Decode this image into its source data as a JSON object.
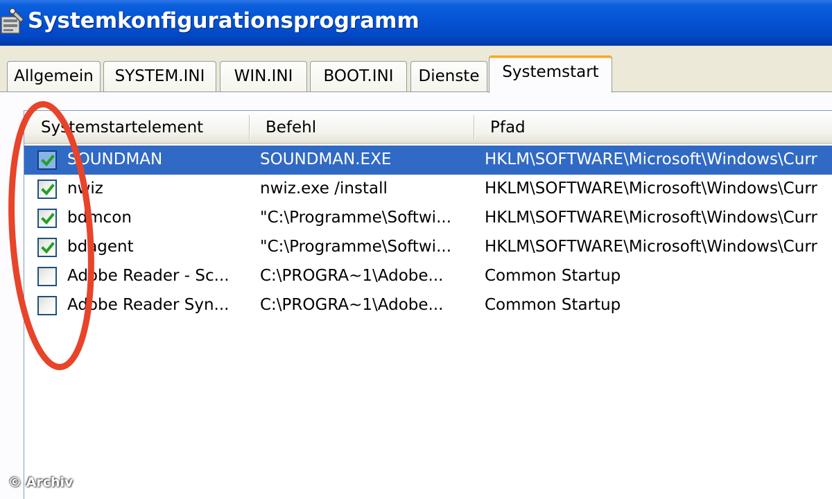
{
  "window": {
    "title": "Systemkonfigurationsprogramm"
  },
  "tabs": [
    {
      "label": "Allgemein",
      "active": false
    },
    {
      "label": "SYSTEM.INI",
      "active": false
    },
    {
      "label": "WIN.INI",
      "active": false
    },
    {
      "label": "BOOT.INI",
      "active": false
    },
    {
      "label": "Dienste",
      "active": false
    },
    {
      "label": "Systemstart",
      "active": true
    }
  ],
  "list": {
    "columns": [
      "Systemstartelement",
      "Befehl",
      "Pfad"
    ],
    "rows": [
      {
        "checked": true,
        "selected": true,
        "element": "SOUNDMAN",
        "command": "SOUNDMAN.EXE",
        "path": "HKLM\\SOFTWARE\\Microsoft\\Windows\\Curr"
      },
      {
        "checked": true,
        "selected": false,
        "element": "nwiz",
        "command": "nwiz.exe /install",
        "path": "HKLM\\SOFTWARE\\Microsoft\\Windows\\Curr"
      },
      {
        "checked": true,
        "selected": false,
        "element": "bdmcon",
        "command": "\"C:\\Programme\\Softwi...",
        "path": "HKLM\\SOFTWARE\\Microsoft\\Windows\\Curr"
      },
      {
        "checked": true,
        "selected": false,
        "element": "bdagent",
        "command": "\"C:\\Programme\\Softwi...",
        "path": "HKLM\\SOFTWARE\\Microsoft\\Windows\\Curr"
      },
      {
        "checked": false,
        "selected": false,
        "element": "Adobe Reader - Sc...",
        "command": "C:\\PROGRA~1\\Adobe...",
        "path": "Common Startup"
      },
      {
        "checked": false,
        "selected": false,
        "element": "Adobe Reader Syn...",
        "command": "C:\\PROGRA~1\\Adobe...",
        "path": "Common Startup"
      }
    ]
  },
  "watermark": "© Archiv",
  "colors": {
    "titlebar": "#0553d3",
    "selection": "#316ac5",
    "active_tab_accent": "#f7a829",
    "checkmark": "#21a121",
    "annotation": "#e8442a"
  },
  "icons": {
    "app": "msconfig-app-icon",
    "check": "checkmark-icon"
  }
}
